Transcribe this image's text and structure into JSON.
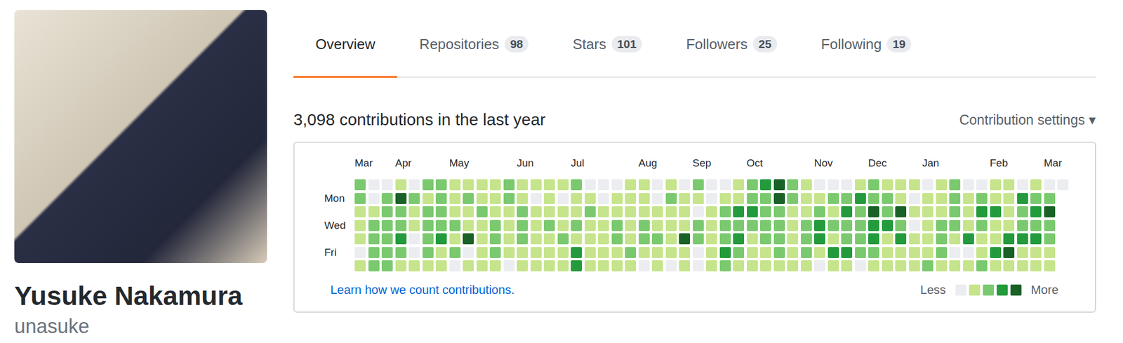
{
  "profile": {
    "name": "Yusuke Nakamura",
    "username": "unasuke"
  },
  "tabs": [
    {
      "label": "Overview",
      "selected": true
    },
    {
      "label": "Repositories",
      "count": "98",
      "selected": false
    },
    {
      "label": "Stars",
      "count": "101",
      "selected": false
    },
    {
      "label": "Followers",
      "count": "25",
      "selected": false
    },
    {
      "label": "Following",
      "count": "19",
      "selected": false
    }
  ],
  "contributions": {
    "heading": "3,098 contributions in the last year",
    "settings": "Contribution settings ▾",
    "months": [
      {
        "label": "Mar",
        "week": 0
      },
      {
        "label": "Apr",
        "week": 3
      },
      {
        "label": "May",
        "week": 7
      },
      {
        "label": "Jun",
        "week": 12
      },
      {
        "label": "Jul",
        "week": 16
      },
      {
        "label": "Aug",
        "week": 21
      },
      {
        "label": "Sep",
        "week": 25
      },
      {
        "label": "Oct",
        "week": 29
      },
      {
        "label": "Nov",
        "week": 34
      },
      {
        "label": "Dec",
        "week": 38
      },
      {
        "label": "Jan",
        "week": 42
      },
      {
        "label": "Feb",
        "week": 47
      },
      {
        "label": "Mar",
        "week": 51
      }
    ],
    "day_labels": [
      {
        "label": "Mon",
        "row": 1
      },
      {
        "label": "Wed",
        "row": 3
      },
      {
        "label": "Fri",
        "row": 5
      }
    ],
    "grid": [
      [
        2,
        0,
        0,
        1,
        0,
        2,
        2,
        1,
        1,
        1,
        1,
        2,
        1,
        1,
        1,
        1,
        2,
        0,
        0,
        0,
        1,
        1,
        0,
        1,
        0,
        2,
        0,
        0,
        1,
        2,
        3,
        4,
        2,
        1,
        0,
        0,
        0,
        1,
        2,
        1,
        1,
        1,
        0,
        1,
        2,
        0,
        0,
        1,
        1,
        0,
        1,
        0,
        0
      ],
      [
        2,
        0,
        2,
        4,
        2,
        1,
        2,
        1,
        2,
        1,
        1,
        2,
        1,
        0,
        1,
        0,
        1,
        1,
        0,
        1,
        1,
        1,
        0,
        2,
        1,
        1,
        0,
        1,
        1,
        2,
        2,
        4,
        2,
        1,
        1,
        2,
        2,
        3,
        2,
        2,
        1,
        0,
        1,
        1,
        2,
        1,
        2,
        1,
        1,
        3,
        2,
        2
      ],
      [
        1,
        1,
        2,
        2,
        1,
        2,
        2,
        1,
        1,
        2,
        1,
        1,
        2,
        1,
        1,
        1,
        1,
        2,
        1,
        1,
        1,
        1,
        1,
        1,
        1,
        0,
        1,
        2,
        3,
        3,
        2,
        2,
        1,
        1,
        2,
        1,
        3,
        2,
        4,
        2,
        4,
        1,
        1,
        1,
        2,
        1,
        3,
        3,
        1,
        2,
        3,
        4
      ],
      [
        1,
        2,
        2,
        2,
        1,
        2,
        2,
        2,
        1,
        1,
        2,
        1,
        2,
        1,
        2,
        1,
        2,
        1,
        1,
        2,
        1,
        2,
        1,
        1,
        1,
        2,
        1,
        2,
        2,
        2,
        2,
        2,
        1,
        2,
        3,
        2,
        2,
        2,
        3,
        3,
        2,
        0,
        1,
        2,
        2,
        1,
        2,
        1,
        1,
        2,
        2,
        2
      ],
      [
        1,
        2,
        2,
        3,
        0,
        2,
        3,
        1,
        4,
        1,
        2,
        1,
        2,
        1,
        1,
        2,
        1,
        1,
        1,
        2,
        1,
        2,
        2,
        1,
        4,
        2,
        1,
        2,
        3,
        1,
        2,
        2,
        1,
        2,
        3,
        1,
        2,
        2,
        3,
        1,
        3,
        1,
        1,
        2,
        1,
        3,
        1,
        1,
        3,
        3,
        3,
        2
      ],
      [
        0,
        2,
        2,
        2,
        0,
        2,
        1,
        2,
        0,
        1,
        2,
        1,
        1,
        1,
        1,
        1,
        3,
        1,
        1,
        1,
        2,
        1,
        1,
        1,
        1,
        0,
        1,
        3,
        2,
        1,
        1,
        2,
        1,
        2,
        1,
        3,
        3,
        2,
        2,
        1,
        1,
        1,
        1,
        2,
        0,
        0,
        1,
        3,
        4,
        1,
        1,
        1
      ],
      [
        1,
        2,
        2,
        1,
        1,
        1,
        1,
        0,
        1,
        1,
        1,
        0,
        1,
        1,
        1,
        1,
        3,
        1,
        1,
        1,
        1,
        0,
        1,
        0,
        1,
        0,
        1,
        2,
        1,
        1,
        1,
        1,
        1,
        1,
        0,
        1,
        1,
        0,
        1,
        1,
        1,
        1,
        2,
        1,
        1,
        1,
        2,
        1,
        1,
        1,
        1,
        1
      ]
    ],
    "learn_link": "Learn how we count contributions.",
    "legend": {
      "less": "Less",
      "more": "More",
      "levels": [
        0,
        1,
        2,
        3,
        4
      ]
    }
  }
}
